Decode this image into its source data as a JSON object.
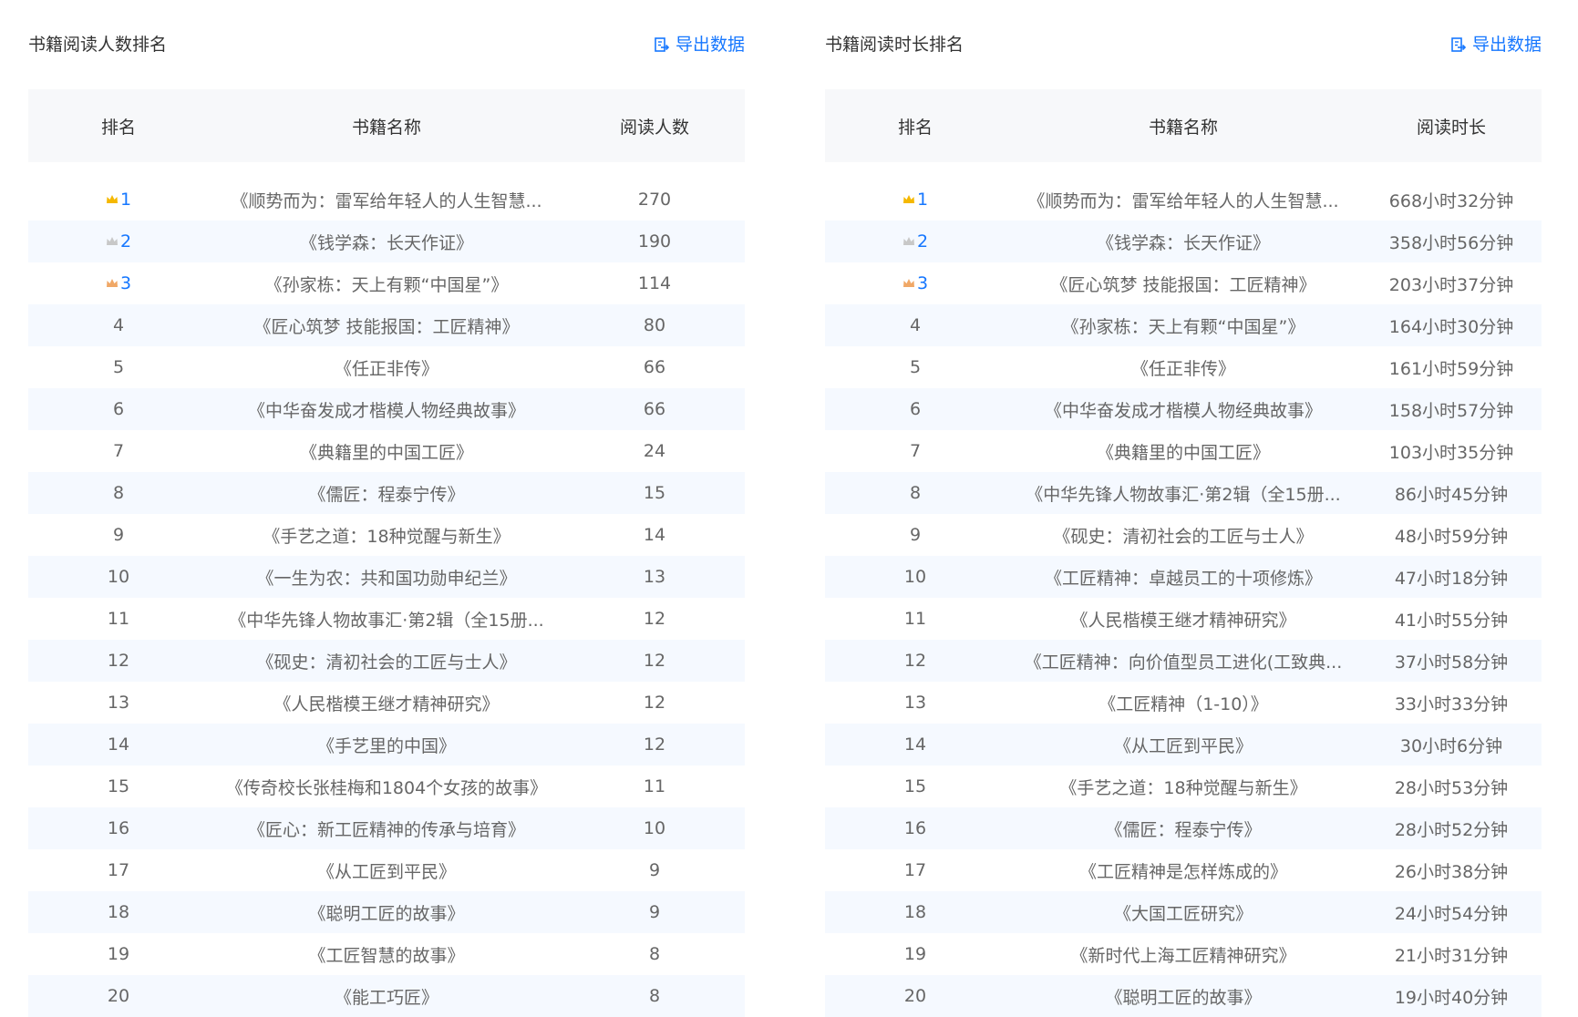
{
  "icons": {
    "export": "export-icon",
    "crown_gold": "#f5b800",
    "crown_silver": "#c8c8c8",
    "crown_bronze": "#f0a867"
  },
  "left": {
    "title": "书籍阅读人数排名",
    "export_label": "导出数据",
    "headers": [
      "排名",
      "书籍名称",
      "阅读人数"
    ],
    "rows": [
      {
        "rank": "1",
        "name": "《顺势而为：雷军给年轻人的人生智慧...",
        "value": "270"
      },
      {
        "rank": "2",
        "name": "《钱学森：长天作证》",
        "value": "190"
      },
      {
        "rank": "3",
        "name": "《孙家栋：天上有颗“中国星”》",
        "value": "114"
      },
      {
        "rank": "4",
        "name": "《匠心筑梦 技能报国：工匠精神》",
        "value": "80"
      },
      {
        "rank": "5",
        "name": "《任正非传》",
        "value": "66"
      },
      {
        "rank": "6",
        "name": "《中华奋发成才楷模人物经典故事》",
        "value": "66"
      },
      {
        "rank": "7",
        "name": "《典籍里的中国工匠》",
        "value": "24"
      },
      {
        "rank": "8",
        "name": "《儒匠：程泰宁传》",
        "value": "15"
      },
      {
        "rank": "9",
        "name": "《手艺之道：18种觉醒与新生》",
        "value": "14"
      },
      {
        "rank": "10",
        "name": "《一生为农：共和国功勋申纪兰》",
        "value": "13"
      },
      {
        "rank": "11",
        "name": "《中华先锋人物故事汇·第2辑（全15册...",
        "value": "12"
      },
      {
        "rank": "12",
        "name": "《砚史：清初社会的工匠与士人》",
        "value": "12"
      },
      {
        "rank": "13",
        "name": "《人民楷模王继才精神研究》",
        "value": "12"
      },
      {
        "rank": "14",
        "name": "《手艺里的中国》",
        "value": "12"
      },
      {
        "rank": "15",
        "name": "《传奇校长张桂梅和1804个女孩的故事》",
        "value": "11"
      },
      {
        "rank": "16",
        "name": "《匠心：新工匠精神的传承与培育》",
        "value": "10"
      },
      {
        "rank": "17",
        "name": "《从工匠到平民》",
        "value": "9"
      },
      {
        "rank": "18",
        "name": "《聪明工匠的故事》",
        "value": "9"
      },
      {
        "rank": "19",
        "name": "《工匠智慧的故事》",
        "value": "8"
      },
      {
        "rank": "20",
        "name": "《能工巧匠》",
        "value": "8"
      }
    ]
  },
  "right": {
    "title": "书籍阅读时长排名",
    "export_label": "导出数据",
    "headers": [
      "排名",
      "书籍名称",
      "阅读时长"
    ],
    "rows": [
      {
        "rank": "1",
        "name": "《顺势而为：雷军给年轻人的人生智慧...",
        "value": "668小时32分钟"
      },
      {
        "rank": "2",
        "name": "《钱学森：长天作证》",
        "value": "358小时56分钟"
      },
      {
        "rank": "3",
        "name": "《匠心筑梦 技能报国：工匠精神》",
        "value": "203小时37分钟"
      },
      {
        "rank": "4",
        "name": "《孙家栋：天上有颗“中国星”》",
        "value": "164小时30分钟"
      },
      {
        "rank": "5",
        "name": "《任正非传》",
        "value": "161小时59分钟"
      },
      {
        "rank": "6",
        "name": "《中华奋发成才楷模人物经典故事》",
        "value": "158小时57分钟"
      },
      {
        "rank": "7",
        "name": "《典籍里的中国工匠》",
        "value": "103小时35分钟"
      },
      {
        "rank": "8",
        "name": "《中华先锋人物故事汇·第2辑（全15册...",
        "value": "86小时45分钟"
      },
      {
        "rank": "9",
        "name": "《砚史：清初社会的工匠与士人》",
        "value": "48小时59分钟"
      },
      {
        "rank": "10",
        "name": "《工匠精神：卓越员工的十项修炼》",
        "value": "47小时18分钟"
      },
      {
        "rank": "11",
        "name": "《人民楷模王继才精神研究》",
        "value": "41小时55分钟"
      },
      {
        "rank": "12",
        "name": "《工匠精神：向价值型员工进化(工致典...",
        "value": "37小时58分钟"
      },
      {
        "rank": "13",
        "name": "《工匠精神（1-10）》",
        "value": "33小时33分钟"
      },
      {
        "rank": "14",
        "name": "《从工匠到平民》",
        "value": "30小时6分钟"
      },
      {
        "rank": "15",
        "name": "《手艺之道：18种觉醒与新生》",
        "value": "28小时53分钟"
      },
      {
        "rank": "16",
        "name": "《儒匠：程泰宁传》",
        "value": "28小时52分钟"
      },
      {
        "rank": "17",
        "name": "《工匠精神是怎样炼成的》",
        "value": "26小时38分钟"
      },
      {
        "rank": "18",
        "name": "《大国工匠研究》",
        "value": "24小时54分钟"
      },
      {
        "rank": "19",
        "name": "《新时代上海工匠精神研究》",
        "value": "21小时31分钟"
      },
      {
        "rank": "20",
        "name": "《聪明工匠的故事》",
        "value": "19小时40分钟"
      }
    ]
  }
}
